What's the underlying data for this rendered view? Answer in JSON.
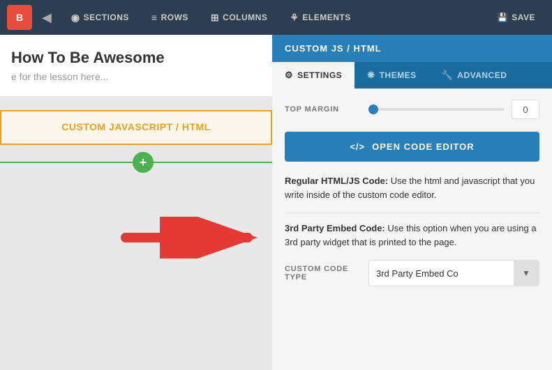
{
  "toolbar": {
    "logo_text": "B",
    "back_icon": "◀",
    "nav_items": [
      {
        "id": "sections",
        "icon": "◉",
        "label": "SECTIONS"
      },
      {
        "id": "rows",
        "icon": "≡",
        "label": "ROWS"
      },
      {
        "id": "columns",
        "icon": "⊞",
        "label": "COLUMNS"
      },
      {
        "id": "elements",
        "icon": "⚘",
        "label": "ELEMENTS"
      }
    ],
    "save_icon": "💾",
    "save_label": "SAVE"
  },
  "canvas": {
    "title": "How To Be Awesome",
    "subtitle": "e for the lesson here...",
    "widget_label": "CUSTOM JAVASCRIPT / HTML",
    "add_plus": "+"
  },
  "panel": {
    "header_title": "CUSTOM JS / HTML",
    "tabs": [
      {
        "id": "settings",
        "icon": "⚙",
        "label": "SETTINGS",
        "active": true
      },
      {
        "id": "themes",
        "icon": "❋",
        "label": "THEMES"
      },
      {
        "id": "advanced",
        "icon": "🔧",
        "label": "ADVANCED"
      }
    ],
    "top_margin_label": "TOP MARGIN",
    "top_margin_value": "0",
    "open_editor_icon": "</>",
    "open_editor_label": "OPEN CODE EDITOR",
    "desc1_title": "Regular HTML/JS Code:",
    "desc1_text": "Use the html and javascript that you write inside of the custom code editor.",
    "desc2_title": "3rd Party Embed Code:",
    "desc2_text": "Use this option when you are using a 3rd party widget that is printed to the page.",
    "custom_code_type_label": "CUSTOM CODE TYPE",
    "custom_code_type_value": "3rd Party Embed Co",
    "dropdown_arrow": "▼"
  },
  "colors": {
    "toolbar_bg": "#2c3e50",
    "panel_header_bg": "#2980b9",
    "panel_tab_bg": "#1a6ca0",
    "open_editor_bg": "#2980b9",
    "widget_border": "#e8a020",
    "add_circle_bg": "#4caf50"
  }
}
